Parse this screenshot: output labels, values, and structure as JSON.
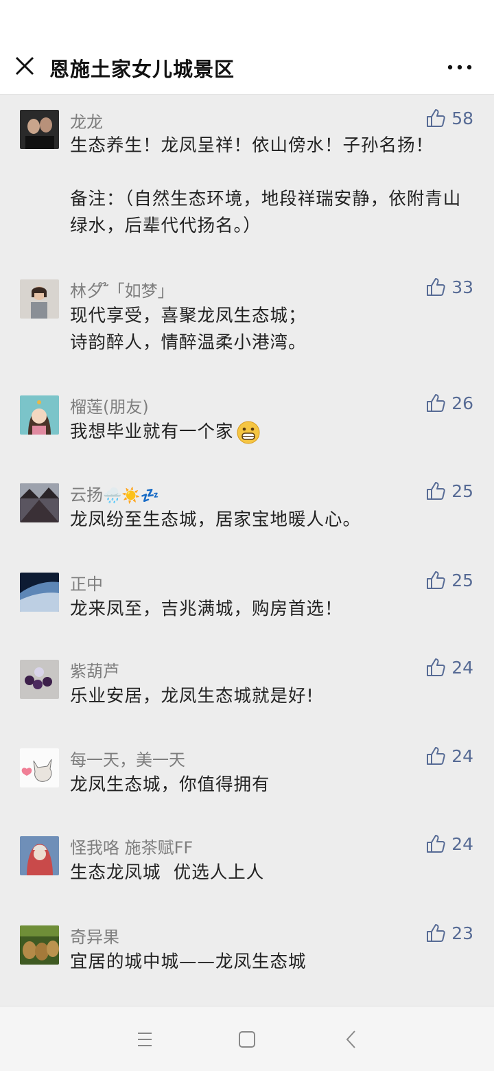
{
  "header": {
    "title": "恩施土家女儿城景区",
    "close_icon": "close-icon",
    "more_icon": "more-dots-icon"
  },
  "colors": {
    "link_blue": "#576b95",
    "background": "#ededed"
  },
  "comments": [
    {
      "name": "龙龙",
      "likes": "58",
      "text": "生态养生！龙凤呈祥！依山傍水！子孙名扬！\n\n备注：（自然生态环境，地段祥瑞安静，依附青山绿水，后辈代代扬名。）"
    },
    {
      "name": "林夕 ໊「如梦」",
      "likes": "33",
      "text": "现代享受，喜聚龙凤生态城；\n诗韵醉人，情醉温柔小港湾。"
    },
    {
      "name": "榴莲(朋友)",
      "likes": "26",
      "text": "我想毕业就有一个家"
    },
    {
      "name": "云扬",
      "name_emoji": "🌧️☀️💤",
      "likes": "25",
      "text": "龙凤纷至生态城，居家宝地暖人心。"
    },
    {
      "name": "正中",
      "likes": "25",
      "text": "龙来凤至，吉兆满城，购房首选！"
    },
    {
      "name": "紫葫芦",
      "likes": "24",
      "text": "乐业安居，龙凤生态城就是好!"
    },
    {
      "name": "每一天，美一天",
      "likes": "24",
      "text": "龙凤生态城，你值得拥有"
    },
    {
      "name": "怪我咯 施茶赋FF",
      "likes": "24",
      "text": "生态龙凤城  优选人上人"
    },
    {
      "name": "奇异果",
      "likes": "23",
      "text": "宜居的城中城——龙凤生态城"
    }
  ],
  "bottom_nav": {
    "menu_icon": "menu-lines-icon",
    "home_icon": "home-square-icon",
    "back_icon": "back-chevron-icon"
  }
}
